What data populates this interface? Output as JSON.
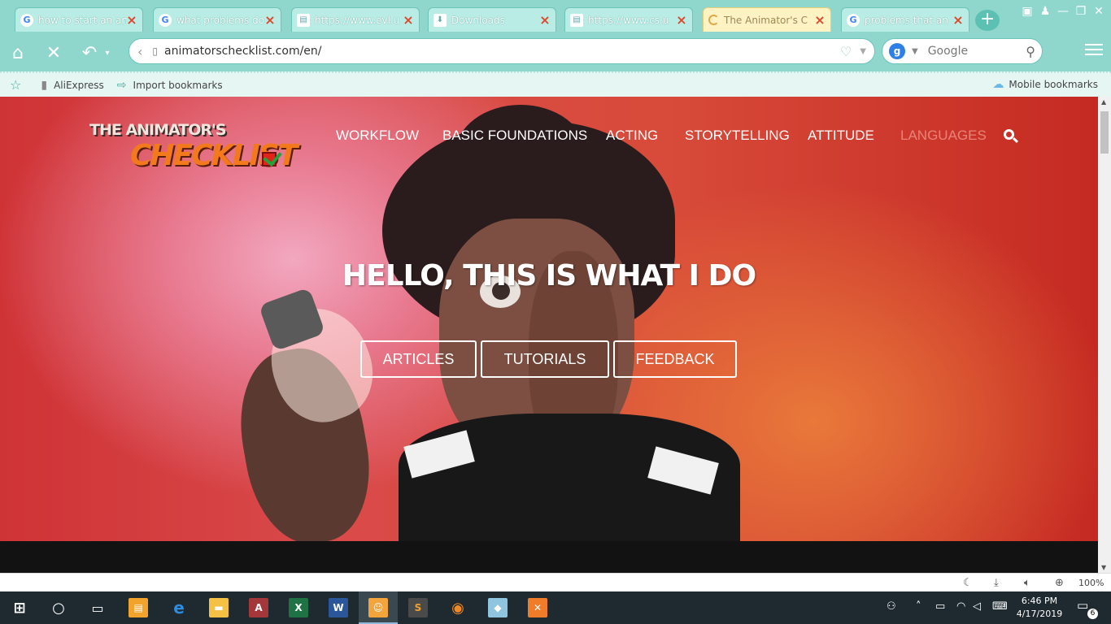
{
  "browser": {
    "tabs": [
      {
        "label": "how to start an an",
        "favicon": "google-icon",
        "active": false
      },
      {
        "label": "what problems do",
        "favicon": "google-icon",
        "active": false
      },
      {
        "label": "https://www.evl.u",
        "favicon": "document-icon",
        "active": false
      },
      {
        "label": "Downloads",
        "favicon": "download-icon",
        "active": false
      },
      {
        "label": "https://www.cs.u",
        "favicon": "document-icon",
        "active": false
      },
      {
        "label": "The Animator's C",
        "favicon": "loading-spinner-icon",
        "active": true
      },
      {
        "label": "problems that an",
        "favicon": "google-icon",
        "active": false
      }
    ],
    "address_url": "animatorschecklist.com/en/",
    "search_engine": "Google",
    "bookmarks": [
      "AliExpress",
      "Import bookmarks"
    ],
    "mobile_bookmarks": "Mobile bookmarks",
    "zoom": "100%"
  },
  "site": {
    "logo_top": "THE ANIMATOR'S",
    "logo_main": "CHECKLIST",
    "nav": [
      "WORKFLOW",
      "BASIC FOUNDATIONS",
      "ACTING",
      "STORYTELLING",
      "ATTITUDE",
      "LANGUAGES"
    ],
    "hero_title": "HELLO, THIS IS WHAT I DO",
    "buttons": [
      "ARTICLES",
      "TUTORIALS",
      "FEEDBACK"
    ]
  },
  "taskbar": {
    "time": "6:46 PM",
    "date": "4/17/2019",
    "notifications": "6"
  },
  "colors": {
    "browser_theme": "#8fd6cd",
    "hero_red": "#d23a36",
    "hero_orange": "#e9783a",
    "logo_orange": "#f27a1c",
    "nav_inactive": "#e9837a"
  }
}
